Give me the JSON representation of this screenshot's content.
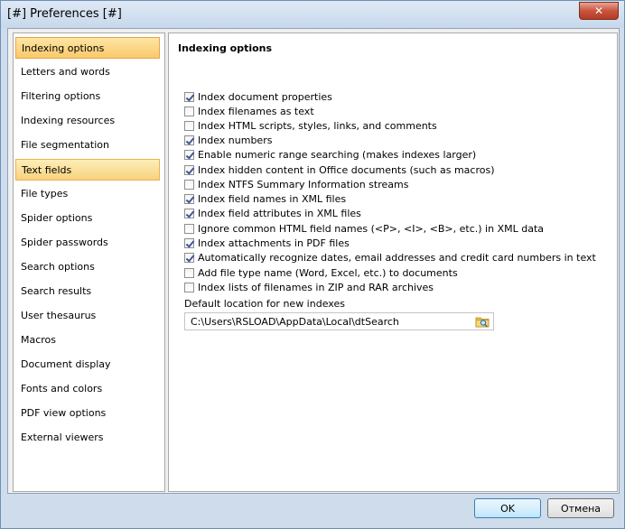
{
  "window": {
    "title": "[#] Preferences [#]",
    "close_glyph": "✕"
  },
  "sidebar": {
    "items": [
      {
        "label": "Indexing options",
        "state": "selected"
      },
      {
        "label": "Letters and words",
        "state": ""
      },
      {
        "label": "Filtering options",
        "state": ""
      },
      {
        "label": "Indexing resources",
        "state": ""
      },
      {
        "label": "File segmentation",
        "state": ""
      },
      {
        "label": "Text fields",
        "state": "highlighted"
      },
      {
        "label": "File types",
        "state": ""
      },
      {
        "label": "Spider options",
        "state": ""
      },
      {
        "label": "Spider passwords",
        "state": ""
      },
      {
        "label": "Search options",
        "state": ""
      },
      {
        "label": "Search results",
        "state": ""
      },
      {
        "label": "User thesaurus",
        "state": ""
      },
      {
        "label": "Macros",
        "state": ""
      },
      {
        "label": "Document display",
        "state": ""
      },
      {
        "label": "Fonts and colors",
        "state": ""
      },
      {
        "label": "PDF view options",
        "state": ""
      },
      {
        "label": "External viewers",
        "state": ""
      }
    ]
  },
  "panel": {
    "title": "Indexing options",
    "options": [
      {
        "label": "Index document properties",
        "checked": true
      },
      {
        "label": "Index filenames as text",
        "checked": false
      },
      {
        "label": "Index HTML scripts, styles, links, and comments",
        "checked": false
      },
      {
        "label": "Index numbers",
        "checked": true
      },
      {
        "label": "Enable numeric range searching (makes indexes larger)",
        "checked": true
      },
      {
        "label": "Index hidden content in Office documents (such as macros)",
        "checked": true
      },
      {
        "label": "Index NTFS Summary Information streams",
        "checked": false
      },
      {
        "label": "Index field names in XML files",
        "checked": true
      },
      {
        "label": "Index field attributes in XML files",
        "checked": true
      },
      {
        "label": "Ignore common HTML field names (<P>, <I>, <B>, etc.) in XML data",
        "checked": false
      },
      {
        "label": "Index attachments in PDF files",
        "checked": true
      },
      {
        "label": "Automatically recognize dates, email addresses and credit card numbers in text",
        "checked": true
      },
      {
        "label": "Add file type name (Word, Excel, etc.) to documents",
        "checked": false
      },
      {
        "label": "Index lists of filenames in ZIP and RAR archives",
        "checked": false
      }
    ],
    "location_label": "Default location for new indexes",
    "location_value": "C:\\Users\\RSLOAD\\AppData\\Local\\dtSearch",
    "browse_icon": "folder-search-icon"
  },
  "buttons": {
    "ok": "OK",
    "cancel": "Отмена"
  }
}
